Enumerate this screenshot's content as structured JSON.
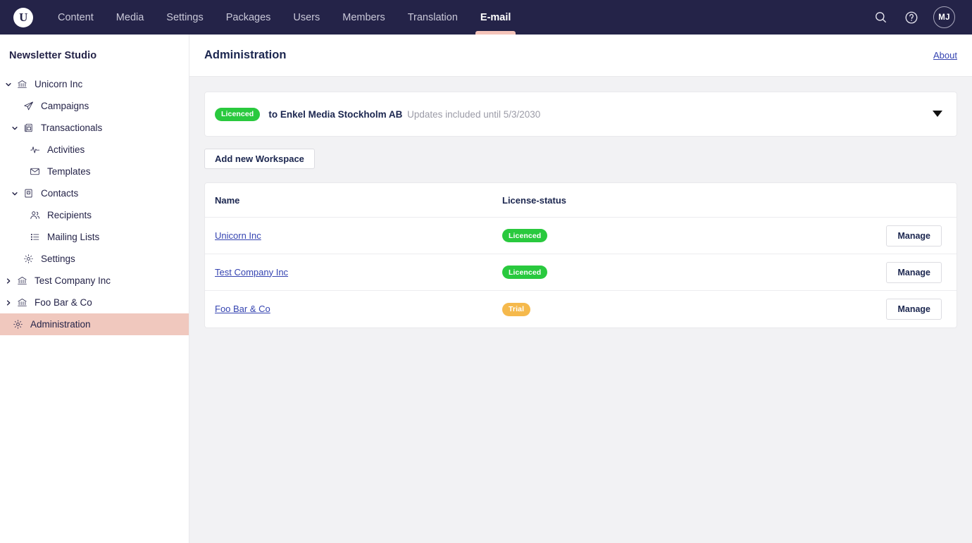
{
  "topbar": {
    "logo": "U",
    "nav": [
      {
        "label": "Content",
        "active": false
      },
      {
        "label": "Media",
        "active": false
      },
      {
        "label": "Settings",
        "active": false
      },
      {
        "label": "Packages",
        "active": false
      },
      {
        "label": "Users",
        "active": false
      },
      {
        "label": "Members",
        "active": false
      },
      {
        "label": "Translation",
        "active": false
      },
      {
        "label": "E-mail",
        "active": true
      }
    ],
    "search_icon": "search-icon",
    "help_icon": "help-circle-icon",
    "avatar_initials": "MJ",
    "accent_color": "#f5c4ba",
    "background_color": "#242348"
  },
  "sidebar": {
    "title": "Newsletter Studio",
    "selected_highlight_color": "#f0c8be",
    "items": [
      {
        "label": "Unicorn Inc",
        "icon": "bank-icon",
        "level": 0,
        "caret": "chevron-down",
        "selected": false
      },
      {
        "label": "Campaigns",
        "icon": "paper-plane-icon",
        "level": 1,
        "caret": "",
        "selected": false
      },
      {
        "label": "Transactionals",
        "icon": "document-icon",
        "level": 1,
        "caret": "chevron-down",
        "selected": false
      },
      {
        "label": "Activities",
        "icon": "pulse-icon",
        "level": 2,
        "caret": "",
        "selected": false
      },
      {
        "label": "Templates",
        "icon": "envelope-icon",
        "level": 2,
        "caret": "",
        "selected": false
      },
      {
        "label": "Contacts",
        "icon": "address-book-icon",
        "level": 1,
        "caret": "chevron-down",
        "selected": false
      },
      {
        "label": "Recipients",
        "icon": "users-icon",
        "level": 2,
        "caret": "",
        "selected": false
      },
      {
        "label": "Mailing Lists",
        "icon": "list-icon",
        "level": 2,
        "caret": "",
        "selected": false
      },
      {
        "label": "Settings",
        "icon": "gear-icon",
        "level": 1,
        "caret": "",
        "selected": false
      },
      {
        "label": "Test Company Inc",
        "icon": "bank-icon",
        "level": 0,
        "caret": "chevron-right",
        "selected": false
      },
      {
        "label": "Foo Bar & Co",
        "icon": "bank-icon",
        "level": 0,
        "caret": "chevron-right",
        "selected": false
      },
      {
        "label": "Administration",
        "icon": "gear-icon",
        "level": -1,
        "caret": "",
        "selected": true
      }
    ]
  },
  "main": {
    "page_title": "Administration",
    "about_label": "About",
    "license": {
      "badge_label": "Licenced",
      "badge_color": "#29c93e",
      "owner_text": "to Enkel Media Stockholm AB",
      "updates_text": "Updates included until 5/3/2030",
      "expand_icon": "caret-down-icon"
    },
    "add_workspace_label": "Add new Workspace",
    "table": {
      "columns": [
        "Name",
        "License-status",
        ""
      ],
      "rows": [
        {
          "name": "Unicorn Inc",
          "status": "Licenced",
          "status_color": "#29c93e",
          "action": "Manage"
        },
        {
          "name": "Test Company Inc",
          "status": "Licenced",
          "status_color": "#29c93e",
          "action": "Manage"
        },
        {
          "name": "Foo Bar & Co",
          "status": "Trial",
          "status_color": "#f5b94c",
          "action": "Manage"
        }
      ]
    }
  }
}
